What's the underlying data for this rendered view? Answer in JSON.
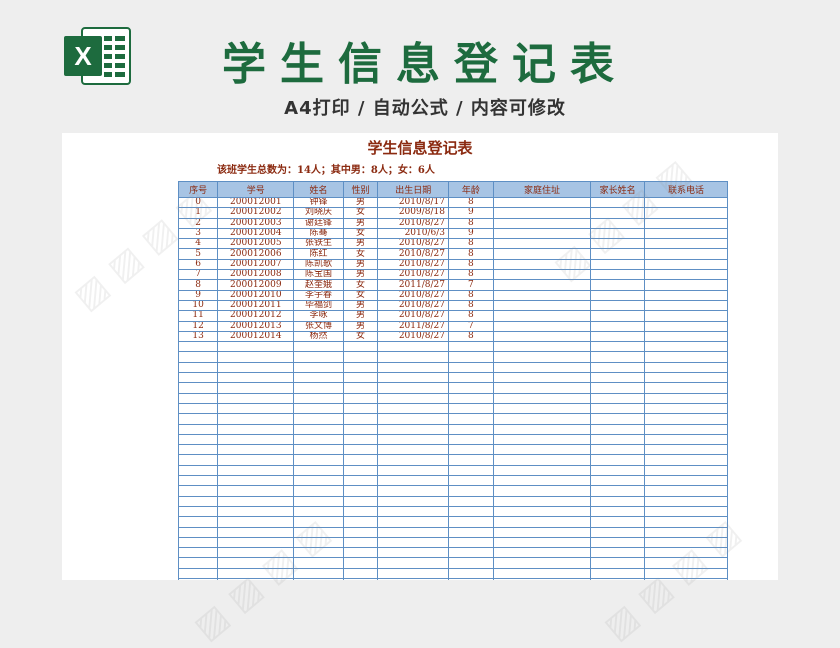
{
  "banner": {
    "title": "学生信息登记表",
    "subtitle": "A4打印 / 自动公式 / 内容可修改",
    "logo_letter": "X",
    "brand_color": "#1d6b3e"
  },
  "sheet": {
    "title": "学生信息登记表",
    "summary": "该班学生总数为：14人；其中男：8人；女：6人",
    "headers": [
      "序号",
      "学号",
      "姓名",
      "性别",
      "出生日期",
      "年龄",
      "家庭住址",
      "家长姓名",
      "联系电话"
    ],
    "rows": [
      [
        "0",
        "200012001",
        "钟锋",
        "男",
        "2010/8/17",
        "8",
        "",
        "",
        ""
      ],
      [
        "1",
        "200012002",
        "刘晓庆",
        "女",
        "2009/8/18",
        "9",
        "",
        "",
        ""
      ],
      [
        "2",
        "200012003",
        "谢廷锋",
        "男",
        "2010/8/27",
        "8",
        "",
        "",
        ""
      ],
      [
        "3",
        "200012004",
        "陈骞",
        "女",
        "2010/6/3",
        "9",
        "",
        "",
        ""
      ],
      [
        "4",
        "200012005",
        "张铁生",
        "男",
        "2010/8/27",
        "8",
        "",
        "",
        ""
      ],
      [
        "5",
        "200012006",
        "陈红",
        "女",
        "2010/8/27",
        "8",
        "",
        "",
        ""
      ],
      [
        "6",
        "200012007",
        "陈凯歌",
        "男",
        "2010/8/27",
        "8",
        "",
        "",
        ""
      ],
      [
        "7",
        "200012008",
        "陈宝国",
        "男",
        "2010/8/27",
        "8",
        "",
        "",
        ""
      ],
      [
        "8",
        "200012009",
        "赵奎娥",
        "女",
        "2011/8/27",
        "7",
        "",
        "",
        ""
      ],
      [
        "9",
        "200012010",
        "李宇春",
        "女",
        "2010/8/27",
        "8",
        "",
        "",
        ""
      ],
      [
        "10",
        "200012011",
        "毕福剑",
        "男",
        "2010/8/27",
        "8",
        "",
        "",
        ""
      ],
      [
        "11",
        "200012012",
        "李咏",
        "男",
        "2010/8/27",
        "8",
        "",
        "",
        ""
      ],
      [
        "12",
        "200012013",
        "张文博",
        "男",
        "2011/8/27",
        "7",
        "",
        "",
        ""
      ],
      [
        "13",
        "200012014",
        "杨然",
        "女",
        "2010/8/27",
        "8",
        "",
        "",
        ""
      ]
    ],
    "empty_rows": 24,
    "header_color": "#a7c4e4",
    "text_color": "#8b2a10",
    "border_color": "#5e8fc4"
  }
}
